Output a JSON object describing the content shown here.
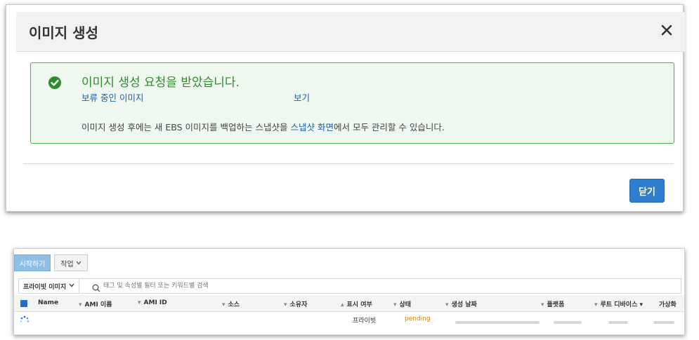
{
  "modal": {
    "title": "이미지 생성",
    "success_title": "이미지 생성 요청을 받았습니다.",
    "pending_link": "보류 중인 이미지",
    "view_link": "보기",
    "info_prefix": "이미지 생성 후에는 새 EBS 이미지를 백업하는 스냅샷을 ",
    "info_link": "스냅샷 화면",
    "info_suffix": "에서 모두 관리할 수 있습니다.",
    "close_button": "닫기"
  },
  "console": {
    "launch_button": "시작하기",
    "actions_button": "작업",
    "filter_select": "프라이빗 이미지",
    "search_placeholder": "태그 및 속성별 필터 또는 키워드별 검색",
    "columns": [
      "Name",
      "AMI 이름",
      "AMI ID",
      "소스",
      "소유자",
      "표시 여부",
      "상태",
      "생성 날짜",
      "플랫폼",
      "루트 디바이스",
      "가상화"
    ],
    "row": {
      "visibility": "프라이빗",
      "status": "pending"
    }
  },
  "colors": {
    "success_green": "#2e8b2e",
    "link_blue": "#1e5ea8",
    "primary_button": "#2f7fd0",
    "pending_orange": "#e07b00"
  },
  "icons": {
    "close": "close-icon",
    "check": "check-circle-icon",
    "search": "search-icon",
    "spinner": "spinner-icon"
  }
}
